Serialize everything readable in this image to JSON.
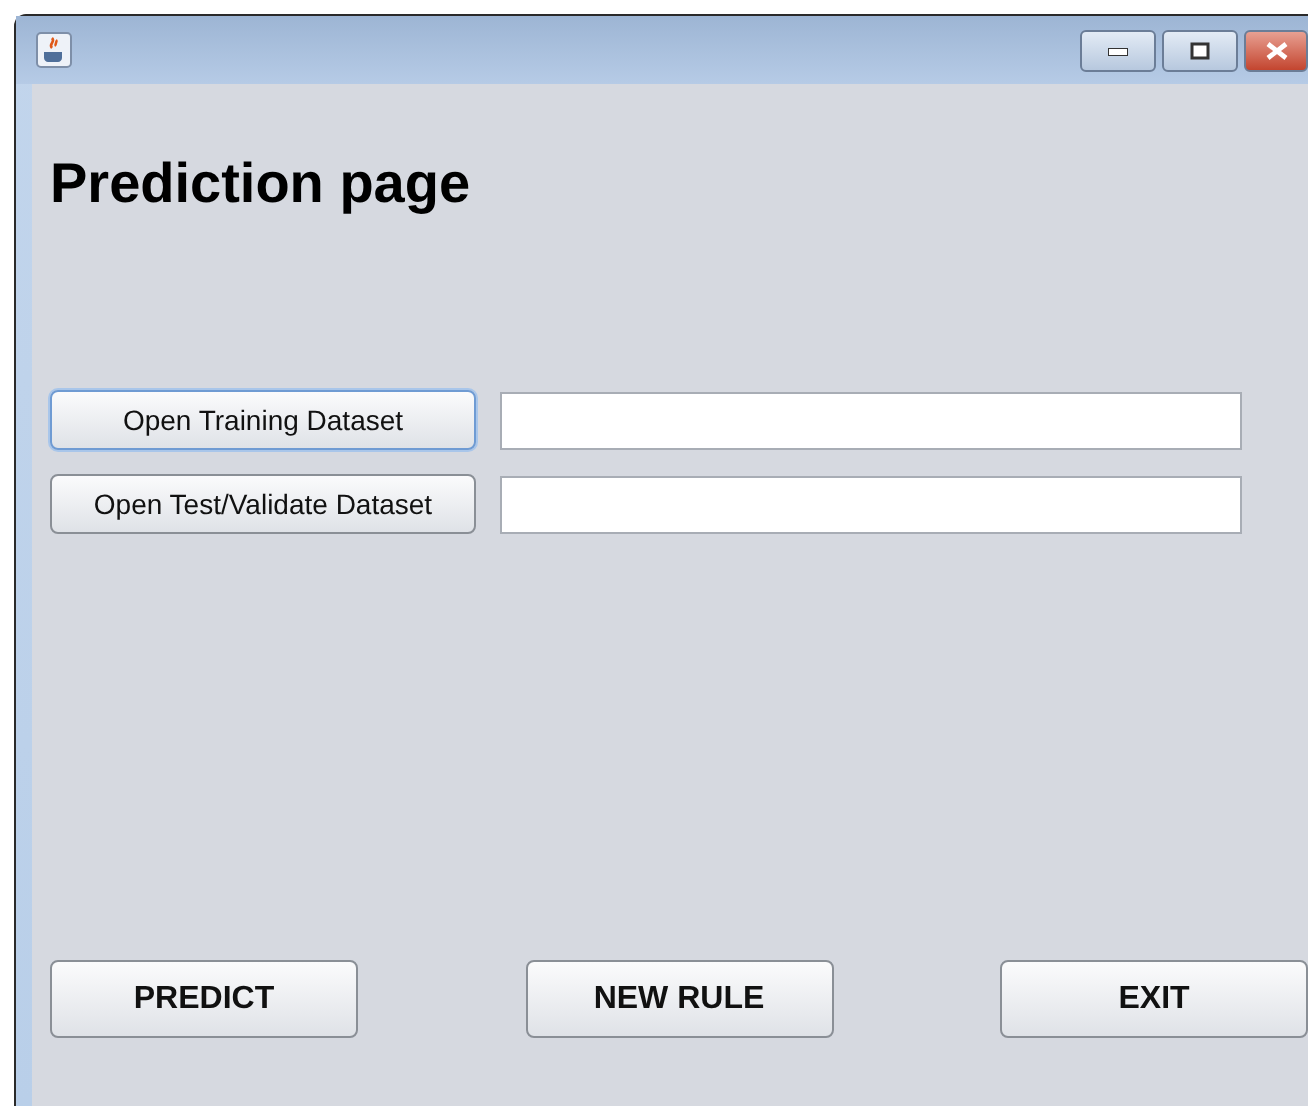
{
  "window": {
    "controls": [
      {
        "kind": "minimize"
      },
      {
        "kind": "maximize"
      },
      {
        "kind": "close"
      }
    ]
  },
  "heading": "Prediction page",
  "dataset_rows": [
    {
      "button": "Open Training Dataset",
      "focused": true,
      "value": ""
    },
    {
      "button": "Open Test/Validate Dataset",
      "focused": false,
      "value": ""
    }
  ],
  "buttons": [
    "PREDICT",
    "NEW RULE",
    "EXIT"
  ]
}
